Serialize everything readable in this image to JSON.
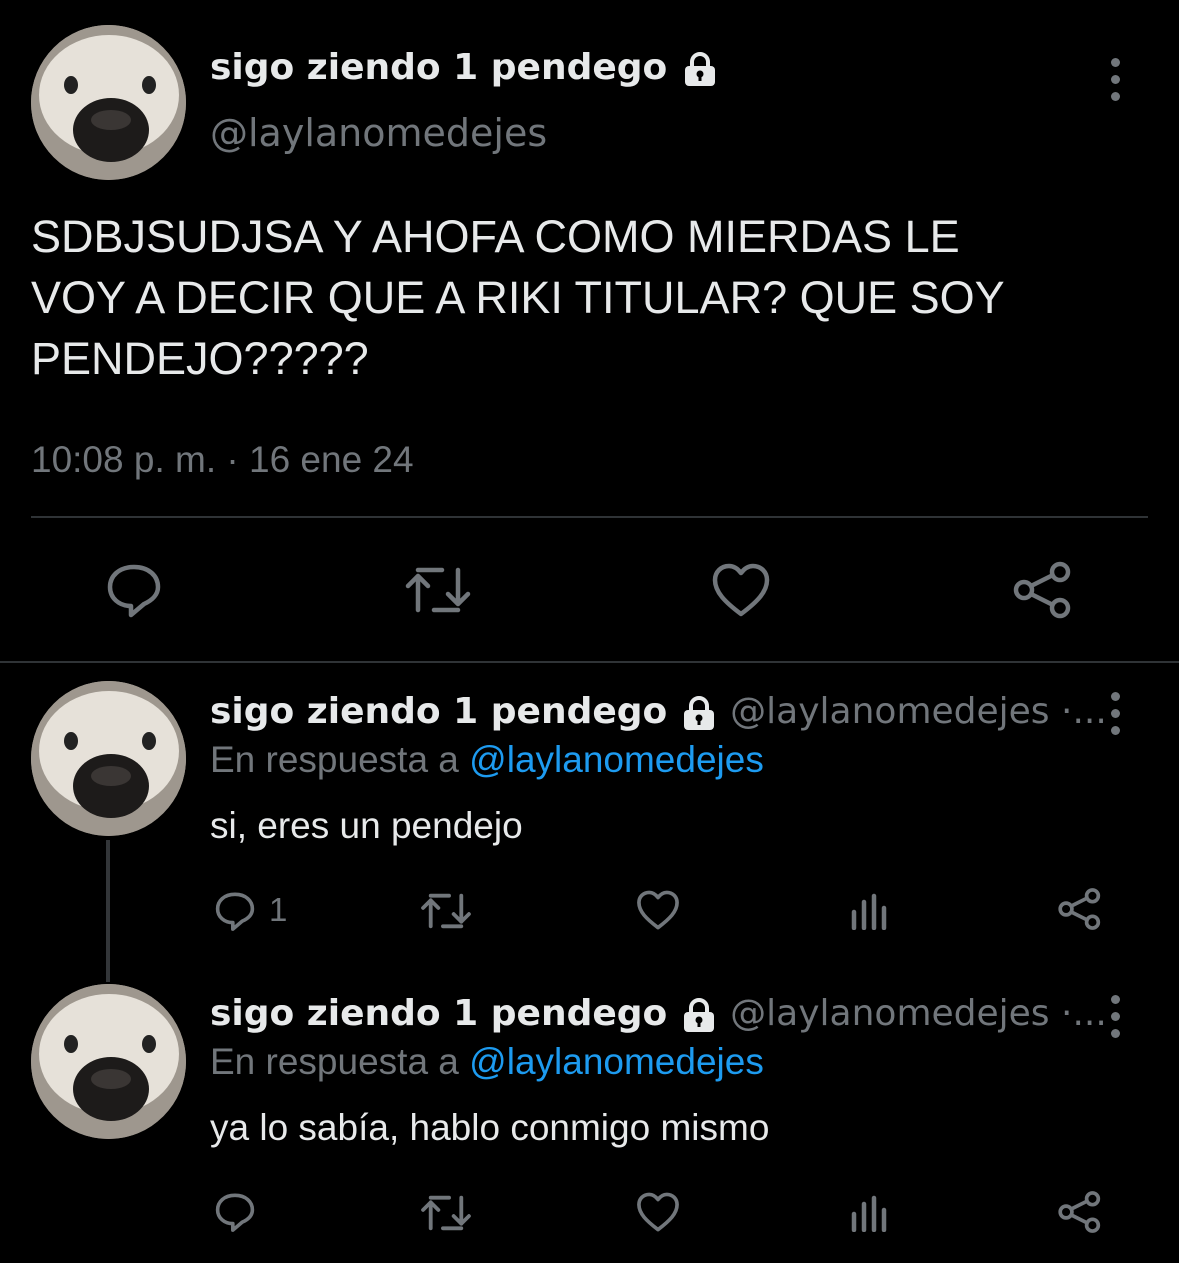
{
  "main_tweet": {
    "display_name": "sigo ziendo 1 pendego",
    "handle": "@laylanomedejes",
    "text_lines": [
      "SDBJSUDJSA Y AHOFA COMO MIERDAS LE",
      "VOY A DECIR QUE A RIKI TITULAR? QUE SOY",
      "PENDEJO?????"
    ],
    "timestamp": "10:08 p. m. · 16 ene 24",
    "actions": [
      "reply-icon",
      "retweet-icon",
      "like-icon",
      "share-icon"
    ]
  },
  "replies": [
    {
      "display_name": "sigo ziendo 1 pendego",
      "handle_meta": "@laylanomedejes ·...",
      "reply_prefix": "En respuesta a",
      "reply_to": "@laylanomedejes",
      "text": "si, eres un pendejo",
      "reply_count": "1"
    },
    {
      "display_name": "sigo ziendo 1 pendego",
      "handle_meta": "@laylanomedejes ·...",
      "reply_prefix": "En respuesta a",
      "reply_to": "@laylanomedejes",
      "text": "ya lo sabía, hablo conmigo mismo",
      "reply_count": ""
    }
  ],
  "colors": {
    "background": "#000000",
    "text": "#e7e9ea",
    "muted": "#71767b",
    "link": "#1d9bf0",
    "divider": "#2f3336"
  }
}
